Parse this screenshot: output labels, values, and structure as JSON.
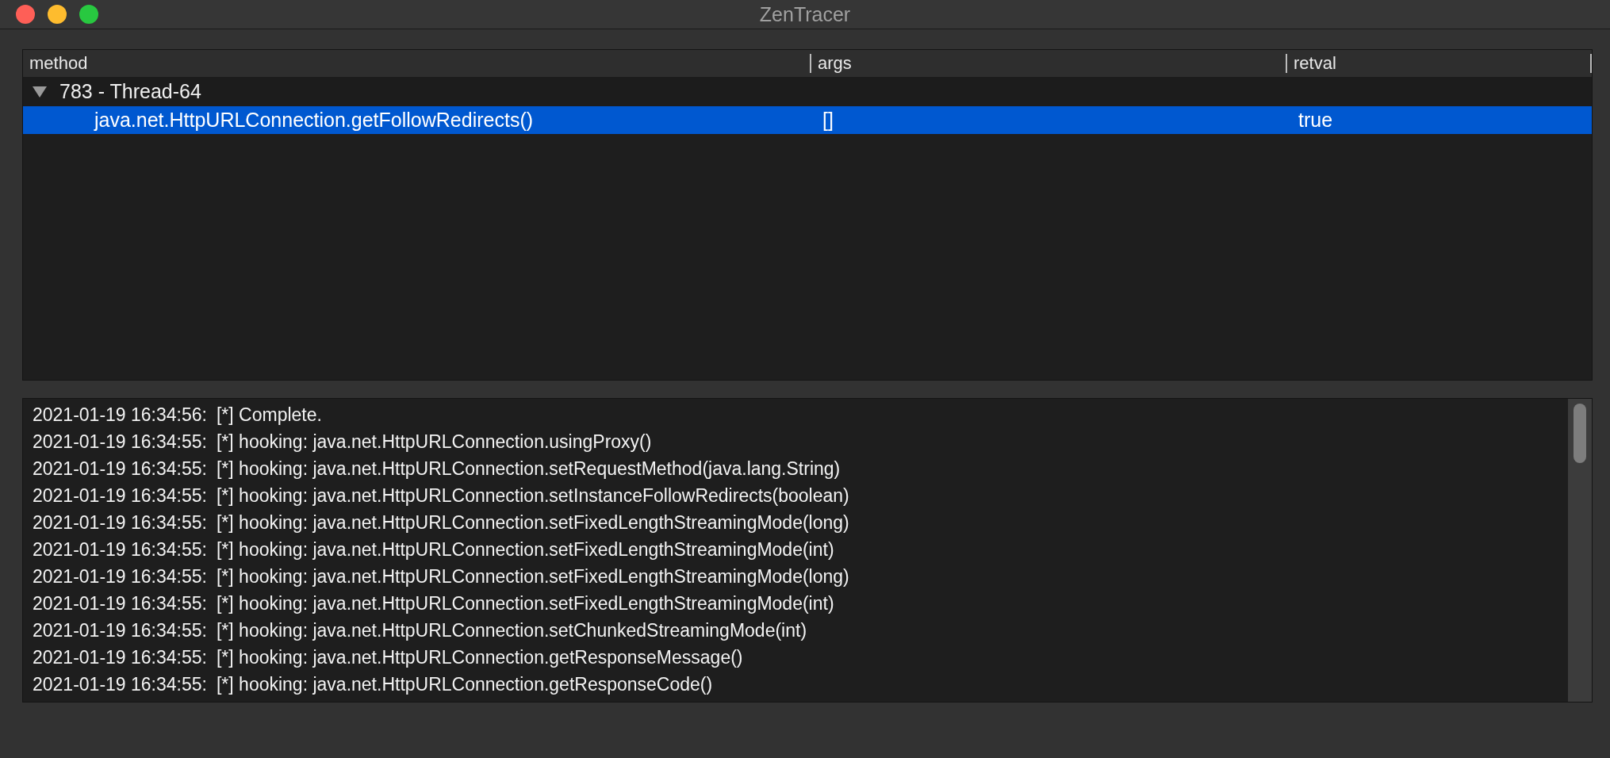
{
  "window": {
    "title": "ZenTracer"
  },
  "table": {
    "columns": [
      "method",
      "args",
      "retval"
    ],
    "rows": [
      {
        "label": "783 - Thread-64",
        "expanded": true,
        "children": [
          {
            "method": "java.net.HttpURLConnection.getFollowRedirects()",
            "args": "[]",
            "retval": "true",
            "selected": true
          }
        ]
      }
    ]
  },
  "log": [
    {
      "time": "2021-01-19 16:34:56:",
      "message": "[*] Complete."
    },
    {
      "time": "2021-01-19 16:34:55:",
      "message": "[*] hooking: java.net.HttpURLConnection.usingProxy()"
    },
    {
      "time": "2021-01-19 16:34:55:",
      "message": "[*] hooking: java.net.HttpURLConnection.setRequestMethod(java.lang.String)"
    },
    {
      "time": "2021-01-19 16:34:55:",
      "message": "[*] hooking: java.net.HttpURLConnection.setInstanceFollowRedirects(boolean)"
    },
    {
      "time": "2021-01-19 16:34:55:",
      "message": "[*] hooking: java.net.HttpURLConnection.setFixedLengthStreamingMode(long)"
    },
    {
      "time": "2021-01-19 16:34:55:",
      "message": "[*] hooking: java.net.HttpURLConnection.setFixedLengthStreamingMode(int)"
    },
    {
      "time": "2021-01-19 16:34:55:",
      "message": "[*] hooking: java.net.HttpURLConnection.setFixedLengthStreamingMode(long)"
    },
    {
      "time": "2021-01-19 16:34:55:",
      "message": "[*] hooking: java.net.HttpURLConnection.setFixedLengthStreamingMode(int)"
    },
    {
      "time": "2021-01-19 16:34:55:",
      "message": "[*] hooking: java.net.HttpURLConnection.setChunkedStreamingMode(int)"
    },
    {
      "time": "2021-01-19 16:34:55:",
      "message": "[*] hooking: java.net.HttpURLConnection.getResponseMessage()"
    },
    {
      "time": "2021-01-19 16:34:55:",
      "message": "[*] hooking: java.net.HttpURLConnection.getResponseCode()"
    }
  ]
}
